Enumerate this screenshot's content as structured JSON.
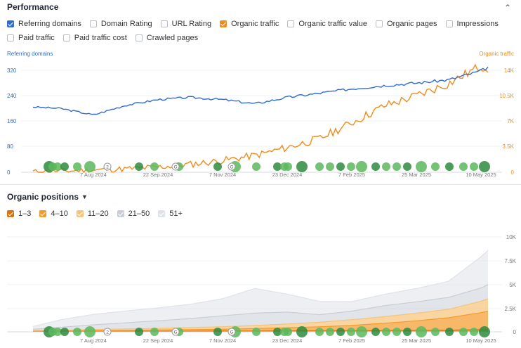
{
  "performance": {
    "title": "Performance",
    "collapse_icon": "chevron-up-icon",
    "metrics": [
      {
        "label": "Referring domains",
        "checked": true,
        "color": "#2f6cd4"
      },
      {
        "label": "Domain Rating",
        "checked": false
      },
      {
        "label": "URL Rating",
        "checked": false
      },
      {
        "label": "Organic traffic",
        "checked": true,
        "color": "#f08c1a"
      },
      {
        "label": "Organic traffic value",
        "checked": false
      },
      {
        "label": "Organic pages",
        "checked": false
      },
      {
        "label": "Impressions",
        "checked": false
      },
      {
        "label": "Paid traffic",
        "checked": false
      },
      {
        "label": "Paid traffic cost",
        "checked": false
      },
      {
        "label": "Crawled pages",
        "checked": false
      }
    ],
    "left_axis_title": "Referring domains",
    "right_axis_title": "Organic traffic",
    "left_ticks": [
      "320",
      "240",
      "160",
      "80",
      "0"
    ],
    "right_ticks": [
      "14K",
      "10.5K",
      "7K",
      "3.5K",
      "0"
    ],
    "x_ticks": [
      "7 Aug 2024",
      "22 Sep 2024",
      "7 Nov 2024",
      "23 Dec 2024",
      "7 Feb 2025",
      "25 Mar 2025",
      "10 May 2025"
    ],
    "event_badges": [
      "2",
      "G",
      "G"
    ]
  },
  "positions": {
    "title": "Organic positions",
    "dropdown_icon": "chevron-down-icon",
    "legend": [
      {
        "label": "1–3",
        "checked": true,
        "color": "#d9730d"
      },
      {
        "label": "4–10",
        "checked": true,
        "color": "#f39a2b"
      },
      {
        "label": "11–20",
        "checked": true,
        "color": "#f7c37a"
      },
      {
        "label": "21–50",
        "checked": true,
        "color": "#c9ced6"
      },
      {
        "label": "51+",
        "checked": true,
        "color": "#dfe2e7"
      }
    ],
    "right_ticks": [
      "10K",
      "7.5K",
      "5K",
      "2.5K",
      "0"
    ],
    "x_ticks": [
      "7 Aug 2024",
      "22 Sep 2024",
      "7 Nov 2024",
      "23 Dec 2024",
      "7 Feb 2025",
      "25 Mar 2025",
      "10 May 2025"
    ],
    "event_badges": [
      "2",
      "G",
      "G"
    ]
  },
  "chart_data": [
    {
      "type": "line",
      "x": [
        "2024-06-25",
        "2024-07-15",
        "2024-08-07",
        "2024-08-30",
        "2024-09-22",
        "2024-10-15",
        "2024-11-07",
        "2024-11-30",
        "2024-12-23",
        "2025-01-15",
        "2025-02-07",
        "2025-03-02",
        "2025-03-25",
        "2025-04-17",
        "2025-05-10",
        "2025-05-15"
      ],
      "series": [
        {
          "name": "Referring domains",
          "axis": "left",
          "color": "#2f6cd4",
          "values": [
            205,
            200,
            180,
            210,
            228,
            235,
            228,
            215,
            235,
            248,
            262,
            272,
            280,
            290,
            318,
            330
          ]
        },
        {
          "name": "Organic traffic",
          "axis": "right",
          "color": "#f08c1a",
          "values": [
            80,
            150,
            300,
            450,
            700,
            1100,
            1600,
            2300,
            3400,
            4600,
            6800,
            9100,
            10500,
            12200,
            14600,
            14300
          ]
        }
      ],
      "left_axis": {
        "title": "Referring domains",
        "range": [
          0,
          320
        ]
      },
      "right_axis": {
        "title": "Organic traffic",
        "range": [
          0,
          14000
        ]
      }
    },
    {
      "type": "area",
      "x": [
        "2024-06-25",
        "2024-07-15",
        "2024-08-07",
        "2024-08-30",
        "2024-09-22",
        "2024-10-15",
        "2024-11-07",
        "2024-11-30",
        "2024-12-23",
        "2025-01-15",
        "2025-02-07",
        "2025-03-02",
        "2025-03-25",
        "2025-04-17",
        "2025-05-10",
        "2025-05-15"
      ],
      "stacked": true,
      "series": [
        {
          "name": "1–3",
          "color": "#d9730d",
          "values": [
            20,
            30,
            40,
            50,
            60,
            70,
            80,
            90,
            100,
            110,
            120,
            140,
            160,
            180,
            220,
            230
          ]
        },
        {
          "name": "4–10",
          "color": "#f39a2b",
          "values": [
            40,
            60,
            80,
            100,
            130,
            160,
            200,
            260,
            330,
            420,
            560,
            760,
            1000,
            1300,
            1800,
            1950
          ]
        },
        {
          "name": "11–20",
          "color": "#f7c37a",
          "values": [
            60,
            90,
            120,
            150,
            180,
            220,
            260,
            320,
            400,
            480,
            600,
            700,
            800,
            900,
            1200,
            1300
          ]
        },
        {
          "name": "21–50",
          "color": "#c9ced6",
          "values": [
            150,
            300,
            500,
            650,
            800,
            950,
            1150,
            1300,
            1250,
            800,
            900,
            1150,
            1200,
            1250,
            1400,
            1500
          ]
        },
        {
          "name": "51+",
          "color": "#dfe2e7",
          "values": [
            300,
            800,
            1100,
            1250,
            1350,
            1500,
            1800,
            2600,
            1900,
            1400,
            1000,
            1200,
            1400,
            1700,
            3300,
            3600
          ]
        }
      ],
      "y_axis": {
        "range": [
          0,
          10000
        ]
      }
    }
  ]
}
